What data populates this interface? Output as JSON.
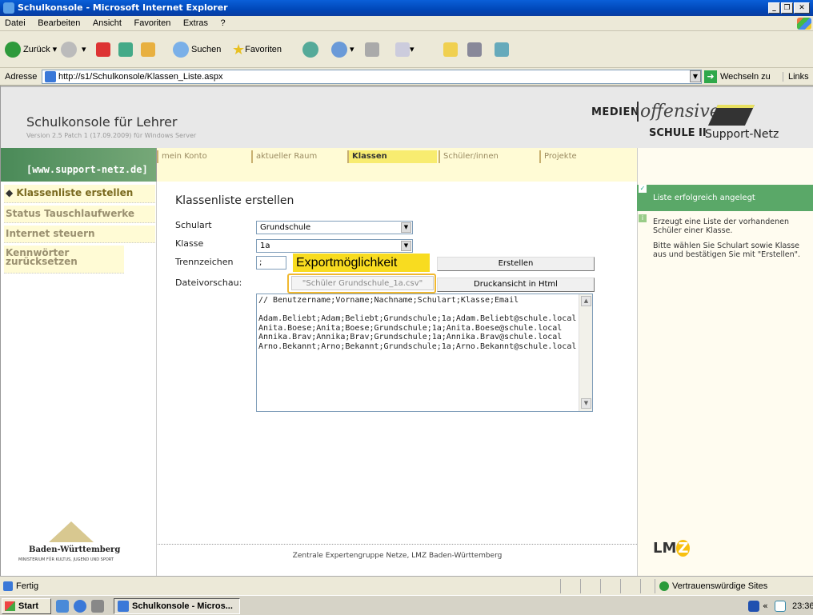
{
  "window": {
    "title": "Schulkonsole - Microsoft Internet Explorer"
  },
  "menu": [
    "Datei",
    "Bearbeiten",
    "Ansicht",
    "Favoriten",
    "Extras",
    "?"
  ],
  "toolbar": {
    "back": "Zurück",
    "search": "Suchen",
    "favorites": "Favoriten"
  },
  "address": {
    "label": "Adresse",
    "url": "http://s1/Schulkonsole/Klassen_Liste.aspx",
    "go": "Wechseln zu",
    "links": "Links"
  },
  "header": {
    "title": "Schulkonsole für Lehrer",
    "version": "Version 2.5 Patch 1 (17.09.2009) für Windows Server",
    "brand1": "MEDIEN",
    "brand2": "offensive",
    "brand3": "SCHULE II",
    "brand4": "Support-Netz"
  },
  "left_link": "[www.support-netz.de]",
  "nav": [
    "mein Konto",
    "aktueller Raum",
    "Klassen",
    "Schüler/innen",
    "Projekte"
  ],
  "sidebar": [
    "Klassenliste erstellen",
    "Status Tauschlaufwerke",
    "Internet steuern",
    "Kennwörter zurücksetzen"
  ],
  "main": {
    "title": "Klassenliste erstellen",
    "schulart_label": "Schulart",
    "schulart_value": "Grundschule",
    "klasse_label": "Klasse",
    "klasse_value": "1a",
    "trenn_label": "Trennzeichen",
    "trenn_value": ";",
    "erstellen": "Erstellen",
    "vorschau_label": "Dateivorschau:",
    "csv_link": "\"Schüler Grundschule_1a.csv\"",
    "druck": "Druckansicht in Html",
    "export_label": "Exportmöglichkeit",
    "preview": "// Benutzername;Vorname;Nachname;Schulart;Klasse;Email\n\nAdam.Beliebt;Adam;Beliebt;Grundschule;1a;Adam.Beliebt@schule.local\nAnita.Boese;Anita;Boese;Grundschule;1a;Anita.Boese@schule.local\nAnnika.Brav;Annika;Brav;Grundschule;1a;Annika.Brav@schule.local\nArno.Bekannt;Arno;Bekannt;Grundschule;1a;Arno.Bekannt@schule.local"
  },
  "footer": "Zentrale Expertengruppe Netze, LMZ Baden-Württemberg",
  "bw": {
    "name": "Baden-Württemberg",
    "sub": "MINISTERIUM FÜR KULTUS, JUGEND UND SPORT"
  },
  "right": {
    "success": "Liste erfolgreich angelegt",
    "info1": "Erzeugt eine Liste der vorhandenen Schüler einer Klasse.",
    "info2": "Bitte wählen Sie Schulart sowie Klasse aus und bestätigen Sie mit \"Erstellen\".",
    "lmz": "LMZ"
  },
  "status": {
    "text": "Fertig",
    "zone": "Vertrauenswürdige Sites"
  },
  "taskbar": {
    "start": "Start",
    "task": "Schulkonsole - Micros...",
    "clock": "23:36"
  }
}
